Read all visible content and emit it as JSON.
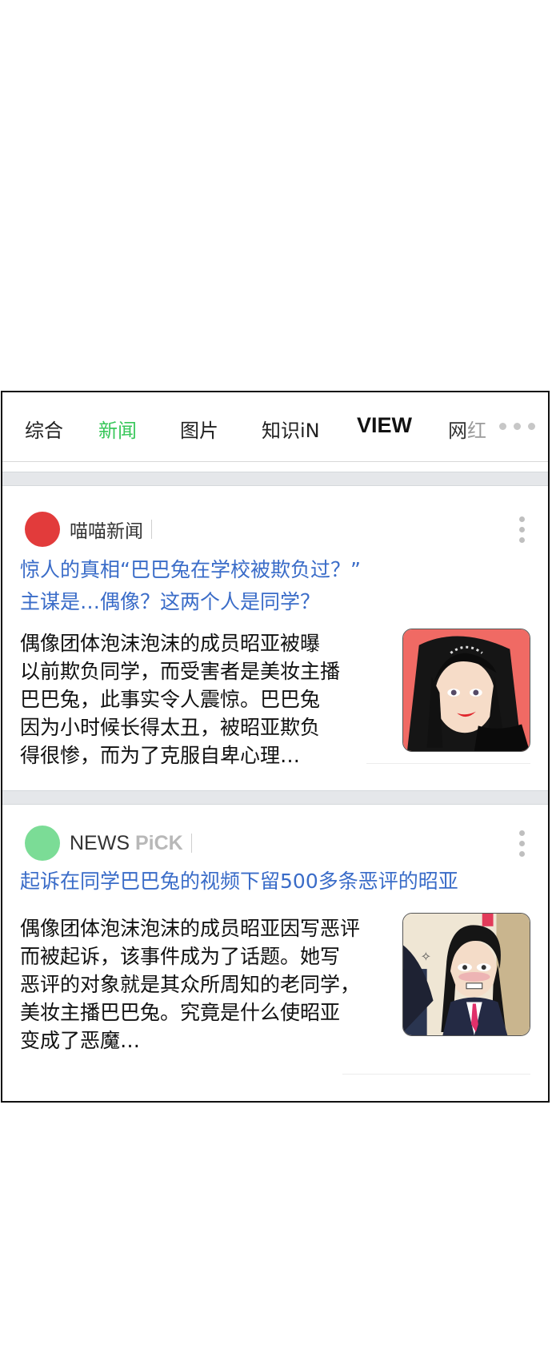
{
  "tabs": [
    {
      "label": "综合"
    },
    {
      "label": "新闻",
      "active": true
    },
    {
      "label": "图片"
    },
    {
      "label": "知识iN"
    },
    {
      "label": "VIEW"
    },
    {
      "label_first": "网",
      "label_rest": "红"
    }
  ],
  "colors": {
    "active_tab": "#38c75a",
    "headline": "#3a6cc8"
  },
  "articles": [
    {
      "source": {
        "name": "喵喵新闻",
        "dot_color": "#e23b3b"
      },
      "headline_lines": [
        "惊人的真相“巴巴兔在学校被欺负过？”",
        "主谋是…偶像？这两个人是同学？"
      ],
      "summary_lines": [
        "偶像团体泡沫泡沫的成员昭亚被曝",
        "以前欺负同学，而受害者是美妆主播",
        "巴巴兔，此事实令人震惊。巴巴兔",
        "因为小时候长得太丑，被昭亚欺负",
        "得很惨，而为了克服自卑心理…"
      ]
    },
    {
      "source": {
        "name_main": "NEWS",
        "name_accent": "PiCK",
        "dot_color": "#7bdc96"
      },
      "headline_lines": [
        "起诉在同学巴巴兔的视频下留500多条恶评的昭亚"
      ],
      "summary_lines": [
        "偶像团体泡沫泡沫的成员昭亚因写恶评",
        "而被起诉，该事件成为了话题。她写",
        "恶评的对象就是其众所周知的老同学，",
        "美妆主播巴巴兔。究竟是什么使昭亚",
        "变成了恶魔…"
      ]
    }
  ]
}
